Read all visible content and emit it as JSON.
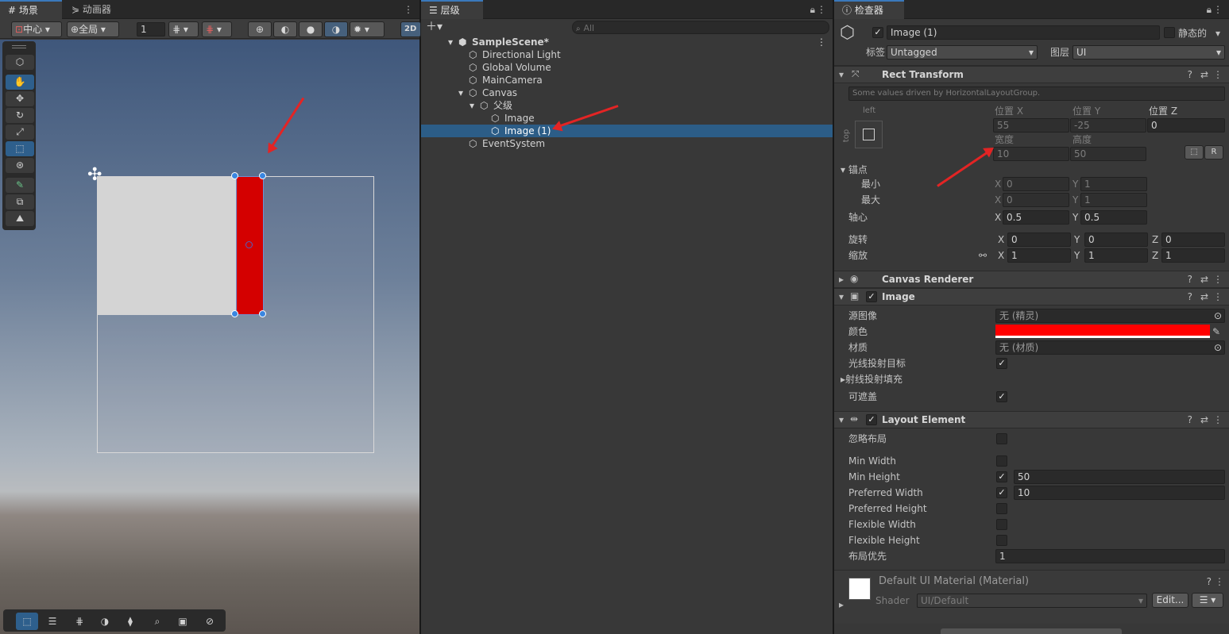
{
  "scene": {
    "tabs": [
      "场景",
      "动画器"
    ],
    "pivot_label": "中心",
    "space_label": "全局",
    "grid_value": "1",
    "mode_2d": "2D",
    "tools": [
      "view-tool",
      "hand-tool",
      "move-tool",
      "rotate-tool",
      "scale-tool",
      "rect-tool",
      "transform-tool",
      "custom-tool",
      "overlay-tool",
      "lighting-tool"
    ],
    "colors": {
      "image_white": "#d4d4d4",
      "image_red": "#d40000"
    }
  },
  "hierarchy": {
    "tab": "层级",
    "search_placeholder": "All",
    "rows": [
      {
        "label": "SampleScene*",
        "level": 0,
        "bold": true,
        "expanded": true
      },
      {
        "label": "Directional Light",
        "level": 1
      },
      {
        "label": "Global Volume",
        "level": 1
      },
      {
        "label": "MainCamera",
        "level": 1
      },
      {
        "label": "Canvas",
        "level": 1,
        "expanded": true
      },
      {
        "label": "父级",
        "level": 2,
        "expanded": true
      },
      {
        "label": "Image",
        "level": 3
      },
      {
        "label": "Image (1)",
        "level": 3,
        "selected": true
      },
      {
        "label": "EventSystem",
        "level": 1
      }
    ]
  },
  "inspector": {
    "tab": "检查器",
    "object_name": "Image (1)",
    "static_label": "静态的",
    "tag_label": "标签",
    "tag_value": "Untagged",
    "layer_label": "图层",
    "layer_value": "UI",
    "rect_transform": {
      "title": "Rect Transform",
      "driven_note": "Some values driven by HorizontalLayoutGroup.",
      "anchor_h": "left",
      "anchor_v": "top",
      "pos_x_label": "位置 X",
      "pos_x": "55",
      "pos_y_label": "位置 Y",
      "pos_y": "-25",
      "pos_z_label": "位置 Z",
      "pos_z": "0",
      "width_label": "宽度",
      "width": "10",
      "height_label": "高度",
      "height": "50",
      "r_button": "R",
      "anchors_label": "锚点",
      "min_label": "最小",
      "min_x": "0",
      "min_y": "1",
      "max_label": "最大",
      "max_x": "0",
      "max_y": "1",
      "pivot_label": "轴心",
      "pivot_x": "0.5",
      "pivot_y": "0.5",
      "rotation_label": "旋转",
      "rot_x": "0",
      "rot_y": "0",
      "rot_z": "0",
      "scale_label": "缩放",
      "scale_x": "1",
      "scale_y": "1",
      "scale_z": "1",
      "x": "X",
      "y": "Y",
      "z": "Z"
    },
    "canvas_renderer": {
      "title": "Canvas Renderer"
    },
    "image": {
      "title": "Image",
      "source_label": "源图像",
      "source_value": "无 (精灵)",
      "color_label": "颜色",
      "color": "#ff0000",
      "material_label": "材质",
      "material_value": "无 (材质)",
      "raycast_label": "光线投射目标",
      "raycast_pad_label": "射线投射填充",
      "maskable_label": "可遮盖"
    },
    "layout_element": {
      "title": "Layout Element",
      "ignore_label": "忽略布局",
      "min_width_label": "Min Width",
      "min_height_label": "Min Height",
      "min_height": "50",
      "pref_width_label": "Preferred Width",
      "pref_width": "10",
      "pref_height_label": "Preferred Height",
      "flex_width_label": "Flexible Width",
      "flex_height_label": "Flexible Height",
      "priority_label": "布局优先",
      "priority": "1"
    },
    "material": {
      "title": "Default UI Material (Material)",
      "shader_label": "Shader",
      "shader_value": "UI/Default",
      "edit_label": "Edit..."
    }
  }
}
